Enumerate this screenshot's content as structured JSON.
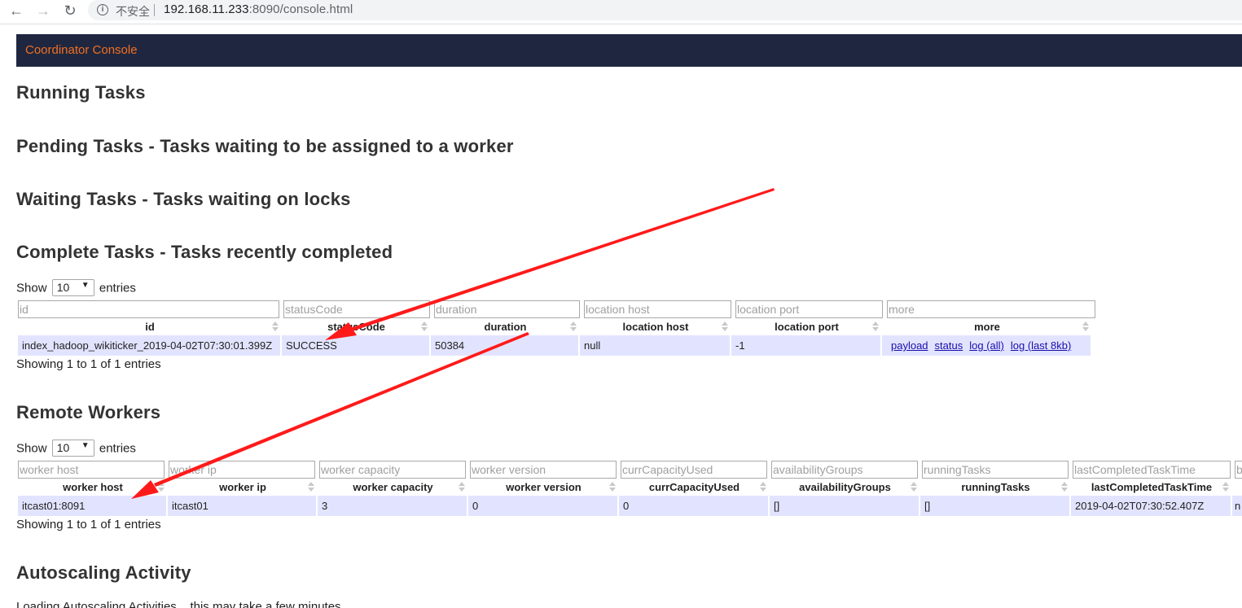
{
  "browser": {
    "security_label": "不安全",
    "url_host": "192.168.11.233",
    "url_path": ":8090/console.html"
  },
  "nav": {
    "brand": "Coordinator Console"
  },
  "sections": {
    "running": "Running Tasks",
    "pending": "Pending Tasks - Tasks waiting to be assigned to a worker",
    "waiting": "Waiting Tasks - Tasks waiting on locks",
    "complete": "Complete Tasks - Tasks recently completed",
    "workers": "Remote Workers",
    "autoscaling": "Autoscaling Activity"
  },
  "length_menu": {
    "show": "Show",
    "value": "10",
    "entries": "entries"
  },
  "complete_table": {
    "columns": [
      "id",
      "statusCode",
      "duration",
      "location host",
      "location port",
      "more"
    ],
    "row": [
      "index_hadoop_wikiticker_2019-04-02T07:30:01.399Z",
      "SUCCESS",
      "50384",
      "null",
      "-1"
    ],
    "links": [
      "payload",
      "status",
      "log (all)",
      "log (last 8kb)"
    ],
    "info": "Showing 1 to 1 of 1 entries"
  },
  "workers_table": {
    "columns": [
      "worker host",
      "worker ip",
      "worker capacity",
      "worker version",
      "currCapacityUsed",
      "availabilityGroups",
      "runningTasks",
      "lastCompletedTaskTime",
      "b"
    ],
    "row": [
      "itcast01:8091",
      "itcast01",
      "3",
      "0",
      "0",
      "[]",
      "[]",
      "2019-04-02T07:30:52.407Z",
      "n"
    ],
    "info": "Showing 1 to 1 of 1 entries"
  },
  "autoscaling": {
    "loading": "Loading Autoscaling Activities... this may take a few minutes"
  },
  "colors": {
    "nav_bg": "#1f2740",
    "brand": "#f26f21",
    "row_bg": "#e2e4ff",
    "arrow": "#ff1a1a"
  }
}
